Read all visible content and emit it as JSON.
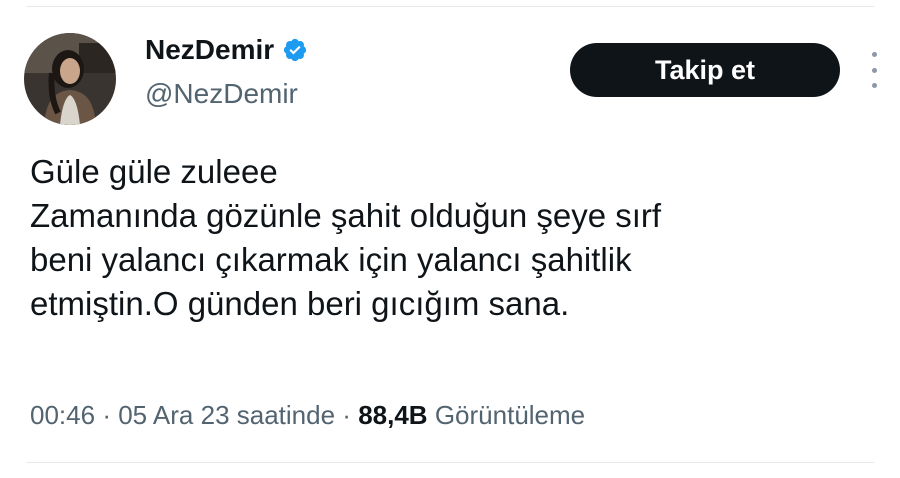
{
  "author": {
    "display_name": "NezDemir",
    "handle": "@NezDemir",
    "verified_icon": "verified-badge-icon",
    "verified_color": "#1d9bf0"
  },
  "actions": {
    "follow_label": "Takip et",
    "more_icon": "more-vertical-icon"
  },
  "tweet": {
    "lines": [
      "Güle güle zuleee",
      "Zamanında gözünle şahit olduğun şeye sırf",
      "beni yalancı çıkarmak için yalancı şahitlik",
      "etmiştin.O günden beri gıcığım sana."
    ]
  },
  "meta": {
    "time": "00:46",
    "separator": "·",
    "date": "05 Ara 23 saatinde",
    "views_count": "88,4B",
    "views_label": "Görüntüleme"
  },
  "colors": {
    "text_primary": "#0f1419",
    "text_secondary": "#536471",
    "button_bg": "#0f1419",
    "button_text": "#ffffff"
  }
}
